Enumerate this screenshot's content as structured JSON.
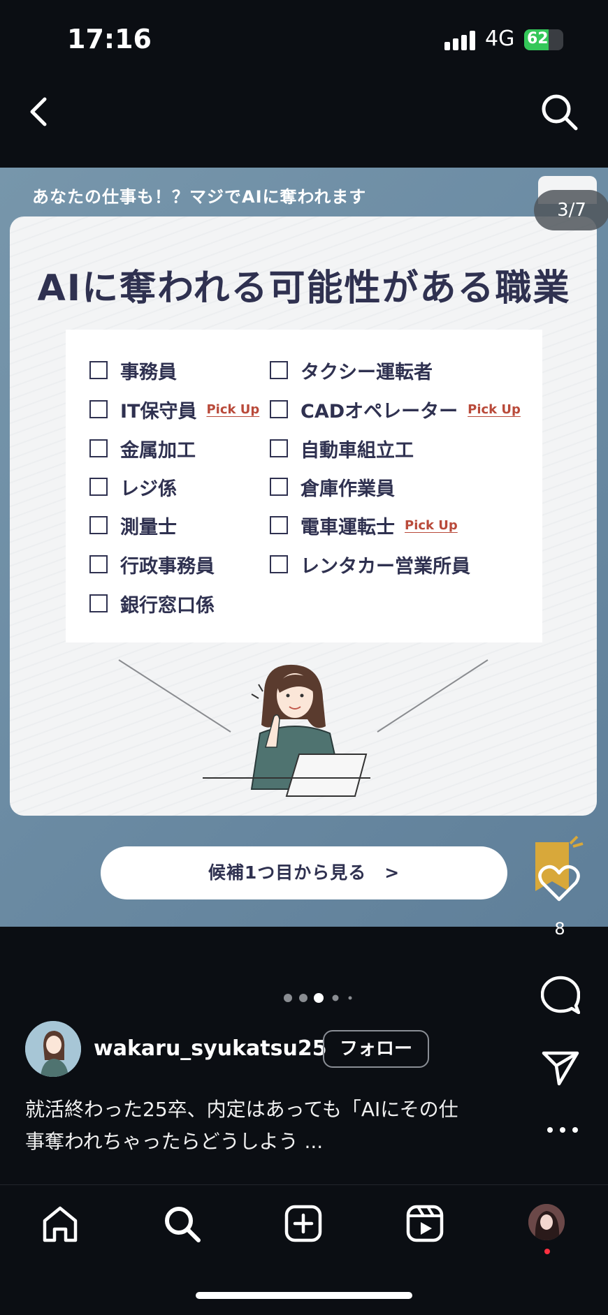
{
  "status_bar": {
    "time": "17:16",
    "network": "4G",
    "battery": "62",
    "battery_level": 0.62
  },
  "post": {
    "banner": "あなたの仕事も！？マジでAIに奪われます",
    "slide_counter": "3/7",
    "title": "AIに奪われる可能性がある職業",
    "jobs_left": [
      {
        "label": "事務員",
        "pick_up": ""
      },
      {
        "label": "IT保守員",
        "pick_up": "Pick Up"
      },
      {
        "label": "金属加工",
        "pick_up": ""
      },
      {
        "label": "レジ係",
        "pick_up": ""
      },
      {
        "label": "測量士",
        "pick_up": ""
      },
      {
        "label": "行政事務員",
        "pick_up": ""
      },
      {
        "label": "銀行窓口係",
        "pick_up": ""
      }
    ],
    "jobs_right": [
      {
        "label": "タクシー運転者",
        "pick_up": ""
      },
      {
        "label": "CADオペレーター",
        "pick_up": "Pick Up"
      },
      {
        "label": "自動車組立工",
        "pick_up": ""
      },
      {
        "label": "倉庫作業員",
        "pick_up": ""
      },
      {
        "label": "電車運転士",
        "pick_up": "Pick Up"
      },
      {
        "label": "レンタカー営業所員",
        "pick_up": ""
      }
    ],
    "cta_label": "候補1つ目から見る　>"
  },
  "actions": {
    "like_count": "8"
  },
  "carousel": {
    "total_dots": 5,
    "active_index": 2
  },
  "profile": {
    "username": "wakaru_syukatsu25",
    "follow_label": "フォロー",
    "caption_line1": "就活終わった25卒、内定はあっても「AIにその仕",
    "caption_line2": "事奪われちゃったらどうしよう ..."
  },
  "icons": {
    "back": "chevron-left-icon",
    "search": "search-icon",
    "like": "heart-icon",
    "comment": "comment-icon",
    "share": "send-icon",
    "more": "more-icon",
    "home": "home-icon",
    "explore": "search-icon",
    "create": "plus-square-icon",
    "reels": "reels-icon"
  },
  "colors": {
    "background": "#0b0e13",
    "accent_red": "#b94a3a",
    "title_navy": "#2f3150",
    "battery_green": "#34c759"
  }
}
